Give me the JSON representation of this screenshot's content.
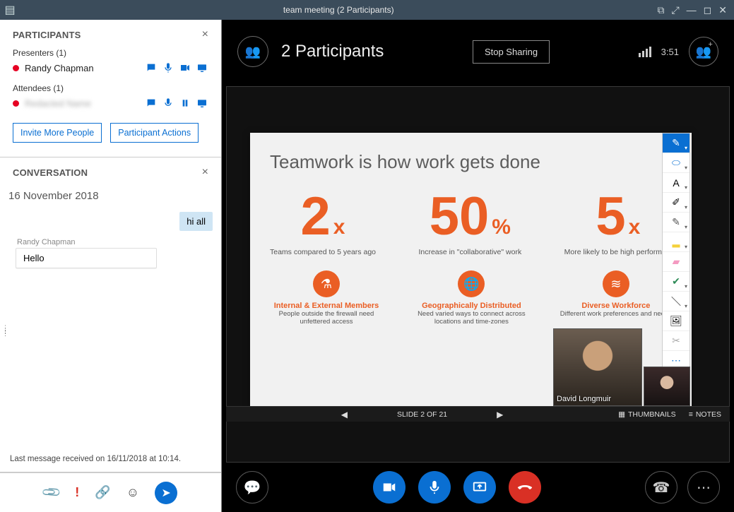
{
  "titlebar": {
    "title": "team meeting (2 Participants)"
  },
  "sidebar": {
    "participants_panel": {
      "title": "PARTICIPANTS",
      "presenters_label": "Presenters (1)",
      "attendees_label": "Attendees (1)",
      "presenter": {
        "name": "Randy Chapman"
      },
      "attendee": {
        "name": "Redacted Name"
      },
      "invite_btn": "Invite More People",
      "actions_btn": "Participant Actions"
    },
    "conversation_panel": {
      "title": "CONVERSATION",
      "date": "16 November 2018",
      "msg1": {
        "text": "hi all"
      },
      "msg2": {
        "sender": "Randy Chapman",
        "text": "Hello"
      },
      "last_received": "Last message received on 16/11/2018 at 10:14."
    }
  },
  "meeting": {
    "header": {
      "title": "2 Participants",
      "stop_sharing": "Stop Sharing",
      "timer": "3:51"
    },
    "slide": {
      "title": "Teamwork is how work gets done",
      "stats": [
        {
          "num": "2",
          "unit": "x",
          "caption": "Teams compared to 5 years ago"
        },
        {
          "num": "50",
          "unit": "%",
          "caption": "Increase in \"collaborative\" work"
        },
        {
          "num": "5",
          "unit": "x",
          "caption": "More likely to be high performing"
        }
      ],
      "features": [
        {
          "title": "Internal & External Members",
          "desc": "People outside the firewall need unfettered access"
        },
        {
          "title": "Geographically Distributed",
          "desc": "Need varied ways to connect across locations and time-zones"
        },
        {
          "title": "Diverse Workforce",
          "desc": "Different work preferences and needs"
        }
      ]
    },
    "pip": {
      "name": "David Longmuir"
    },
    "slidenav": {
      "counter": "SLIDE 2 OF 21",
      "thumbnails": "THUMBNAILS",
      "notes": "NOTES"
    }
  }
}
